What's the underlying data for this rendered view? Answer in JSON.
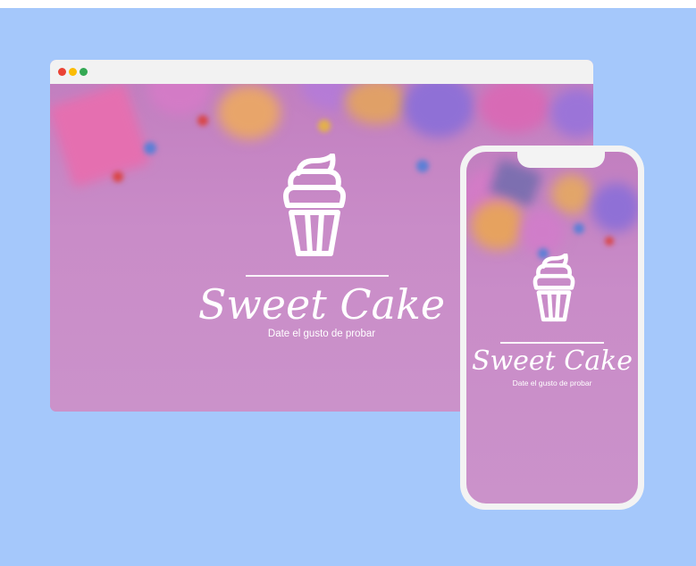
{
  "desktop": {
    "brand_title": "Sweet Cake",
    "tagline": "Date el gusto de probar"
  },
  "mobile": {
    "brand_title": "Sweet Cake",
    "tagline": "Date el gusto de probar"
  },
  "colors": {
    "page_background": "#a5c8fb",
    "hero_pink": "#c98cc8",
    "browser_bar": "#f2f2f2",
    "dot_red": "#ea4335",
    "dot_yellow": "#fbbc05",
    "dot_green": "#34a853"
  },
  "icons": [
    "cupcake-logo-icon"
  ]
}
